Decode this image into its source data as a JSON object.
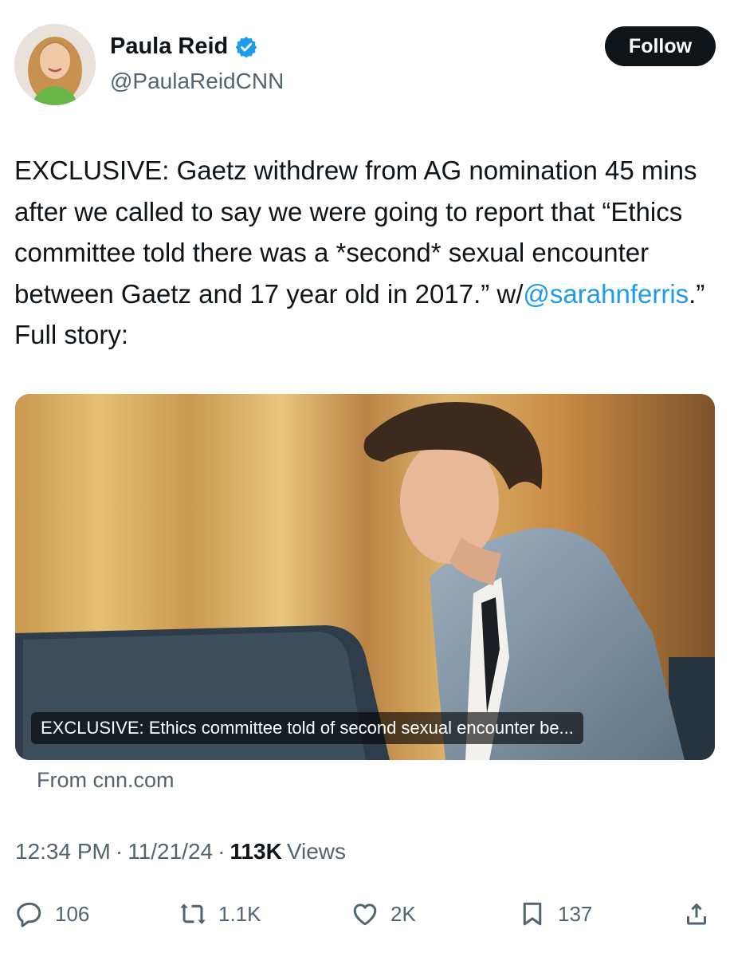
{
  "author": {
    "name": "Paula Reid",
    "handle": "@PaulaReidCNN",
    "verified_icon": "verified-badge-icon",
    "follow_label": "Follow"
  },
  "tweet": {
    "text_before_mention": "EXCLUSIVE: Gaetz withdrew from AG nomination 45 mins after we called to say we were going to report that “Ethics committee told there was a *second* sexual encounter between Gaetz and 17 year old in 2017.” w/",
    "mention": "@sarahnferris",
    "text_after_mention": ".” Full story:"
  },
  "card": {
    "caption": "EXCLUSIVE: Ethics committee told of second sexual encounter be...",
    "source": "From cnn.com"
  },
  "meta": {
    "time": "12:34 PM",
    "sep1": "·",
    "date": "11/21/24",
    "sep2": "·",
    "views_count": "113K",
    "views_label": "Views"
  },
  "actions": {
    "replies": "106",
    "reposts": "1.1K",
    "likes": "2K",
    "bookmarks": "137"
  },
  "colors": {
    "text": "#0f1419",
    "secondary": "#536471",
    "link": "#1d9bf0",
    "verified": "#1d9bf0"
  }
}
